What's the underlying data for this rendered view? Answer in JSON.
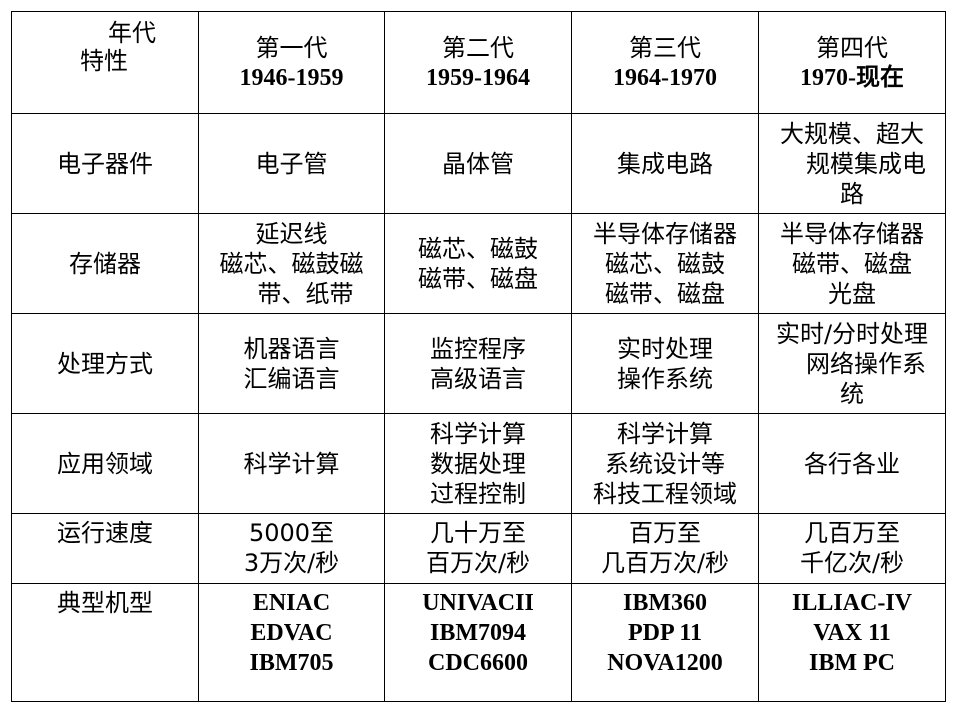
{
  "corner": {
    "top": "年代",
    "bottom": "特性"
  },
  "generations": [
    {
      "name": "第一代",
      "years": "1946-1959"
    },
    {
      "name": "第二代",
      "years": "1959-1964"
    },
    {
      "name": "第三代",
      "years": "1964-1970"
    },
    {
      "name": "第四代",
      "years": "1970-现在"
    }
  ],
  "rows": [
    {
      "label": "电子器件",
      "cells": [
        [
          "电子管"
        ],
        [
          "晶体管"
        ],
        [
          "集成电路"
        ],
        [
          "大规模、超大",
          "规模集成电",
          "路"
        ]
      ]
    },
    {
      "label": "存储器",
      "cells": [
        [
          "延迟线",
          "磁芯、磁鼓磁",
          "带、纸带"
        ],
        [
          "磁芯、磁鼓",
          "磁带、磁盘"
        ],
        [
          "半导体存储器",
          "磁芯、磁鼓",
          "磁带、磁盘"
        ],
        [
          "半导体存储器",
          "磁带、磁盘",
          "光盘"
        ]
      ]
    },
    {
      "label": "处理方式",
      "cells": [
        [
          "机器语言",
          "汇编语言"
        ],
        [
          "监控程序",
          "高级语言"
        ],
        [
          "实时处理",
          "操作系统"
        ],
        [
          "实时/分时处理",
          "网络操作系",
          "统"
        ]
      ]
    },
    {
      "label": "应用领域",
      "cells": [
        [
          "科学计算"
        ],
        [
          "科学计算",
          "数据处理",
          "过程控制"
        ],
        [
          "科学计算",
          "系统设计等",
          "科技工程领域"
        ],
        [
          "各行各业"
        ]
      ]
    },
    {
      "label": "运行速度",
      "cells": [
        [
          "5000至",
          "3万次/秒"
        ],
        [
          "几十万至",
          "百万次/秒"
        ],
        [
          "百万至",
          "几百万次/秒"
        ],
        [
          "几百万至",
          "千亿次/秒"
        ]
      ]
    },
    {
      "label": "典型机型",
      "cells": [
        [
          "ENIAC",
          "EDVAC",
          "IBM705"
        ],
        [
          "UNIVACII",
          "IBM7094",
          "CDC6600"
        ],
        [
          "IBM360",
          "PDP 11",
          "NOVA1200"
        ],
        [
          "ILLIAC-IV",
          "VAX 11",
          "IBM PC"
        ]
      ]
    }
  ]
}
